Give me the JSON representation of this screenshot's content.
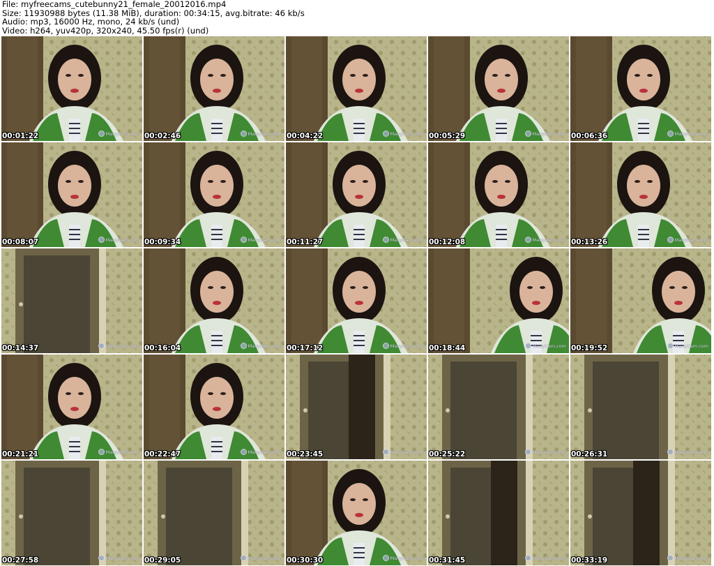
{
  "header": {
    "file": "File: myfreecams_cutebunny21_female_20012016.mp4",
    "size": "Size: 11930988 bytes (11.38 MiB), duration: 00:34:15, avg.bitrate: 46 kb/s",
    "audio": "Audio: mp3, 16000 Hz, mono, 24 kb/s (und)",
    "video": "Video: h264, yuv420p, 320x240, 45.50 fps(r) (und)"
  },
  "watermark": "ManyCam.com",
  "thumbnails": [
    {
      "time": "00:01:22",
      "scene": "person"
    },
    {
      "time": "00:02:46",
      "scene": "person"
    },
    {
      "time": "00:04:22",
      "scene": "person"
    },
    {
      "time": "00:05:29",
      "scene": "person"
    },
    {
      "time": "00:06:36",
      "scene": "person"
    },
    {
      "time": "00:08:07",
      "scene": "person"
    },
    {
      "time": "00:09:34",
      "scene": "person"
    },
    {
      "time": "00:11:27",
      "scene": "person"
    },
    {
      "time": "00:12:08",
      "scene": "person"
    },
    {
      "time": "00:13:26",
      "scene": "person"
    },
    {
      "time": "00:14:37",
      "scene": "room-door"
    },
    {
      "time": "00:16:04",
      "scene": "person"
    },
    {
      "time": "00:17:12",
      "scene": "person"
    },
    {
      "time": "00:18:44",
      "scene": "person-partial"
    },
    {
      "time": "00:19:52",
      "scene": "person-partial"
    },
    {
      "time": "00:21:21",
      "scene": "person"
    },
    {
      "time": "00:22:47",
      "scene": "person"
    },
    {
      "time": "00:23:45",
      "scene": "room"
    },
    {
      "time": "00:25:22",
      "scene": "room-door"
    },
    {
      "time": "00:26:31",
      "scene": "room-door"
    },
    {
      "time": "00:27:58",
      "scene": "room-door"
    },
    {
      "time": "00:29:05",
      "scene": "room-door"
    },
    {
      "time": "00:30:30",
      "scene": "person"
    },
    {
      "time": "00:31:45",
      "scene": "room"
    },
    {
      "time": "00:33:19",
      "scene": "room"
    }
  ],
  "colors": {
    "wallpaper": "#b9b58a",
    "door": "#5a4a30",
    "jacket": "#3f8a32",
    "hair": "#1b1410",
    "skin": "#d9b39a"
  }
}
